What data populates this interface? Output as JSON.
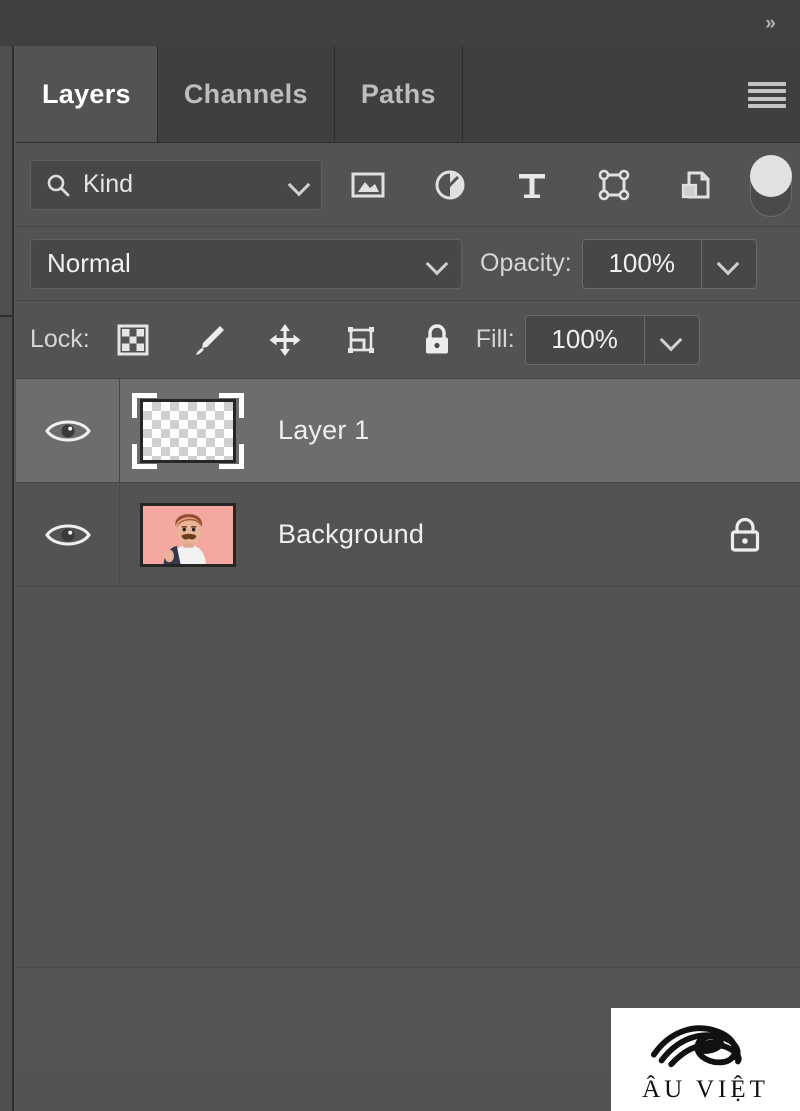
{
  "window": {
    "collapse_icon": "double-chevron-right-icon",
    "panel_menu_icon": "hamburger-menu-icon"
  },
  "tabs": [
    {
      "label": "Layers",
      "active": true
    },
    {
      "label": "Channels",
      "active": false
    },
    {
      "label": "Paths",
      "active": false
    }
  ],
  "filter": {
    "search_icon": "magnifier-icon",
    "kind_label": "Kind",
    "kind_chevron": "chevron-down-icon",
    "type_filters": [
      {
        "name": "pixel-layer-filter-icon",
        "title": "Filter for pixel layers"
      },
      {
        "name": "adjustment-layer-filter-icon",
        "title": "Filter for adjustment layers"
      },
      {
        "name": "type-layer-filter-icon",
        "title": "Filter for type layers"
      },
      {
        "name": "shape-layer-filter-icon",
        "title": "Filter for shape layers"
      },
      {
        "name": "smart-object-filter-icon",
        "title": "Filter for smart objects"
      }
    ],
    "toggle_name": "filter-enable-toggle",
    "toggle_state": "on"
  },
  "blend": {
    "mode_value": "Normal",
    "mode_chevron": "chevron-down-icon",
    "opacity_label": "Opacity:",
    "opacity_value": "100%",
    "opacity_chevron": "chevron-down-icon"
  },
  "lock": {
    "label": "Lock:",
    "buttons": [
      {
        "name": "lock-transparent-pixels-icon"
      },
      {
        "name": "lock-image-pixels-brush-icon"
      },
      {
        "name": "lock-position-move-icon"
      },
      {
        "name": "lock-artboard-nesting-icon"
      },
      {
        "name": "lock-all-padlock-icon"
      }
    ],
    "fill_label": "Fill:",
    "fill_value": "100%",
    "fill_chevron": "chevron-down-icon"
  },
  "layers": [
    {
      "name": "Layer 1",
      "visible": true,
      "selected": true,
      "thumbnail": "transparent-checkerboard",
      "locked": false,
      "eye_icon": "eye-visibility-icon"
    },
    {
      "name": "Background",
      "visible": true,
      "selected": false,
      "thumbnail": "photo-man-with-mustache",
      "locked": true,
      "lock_icon": "padlock-icon",
      "eye_icon": "eye-visibility-icon"
    }
  ],
  "thumbnail_colors": {
    "background_pink": "#f4a8a0",
    "hair_brown": "#a8603a",
    "skin": "#e8b49a",
    "shirt_white": "#f2f2f2",
    "jacket_dark": "#33384d"
  },
  "theme": {
    "panel_bg": "#535353",
    "tabbar_bg": "#3f3f3f",
    "topstrip_bg": "#404040",
    "selected_row": "#6d6d6d",
    "text_primary": "#efefef",
    "text_muted": "#bdbdbd",
    "field_bg": "#474747",
    "field_border": "#606060"
  },
  "watermark": {
    "text": "ÂU VIỆT",
    "logo_icon": "stylized-eye-logo"
  }
}
